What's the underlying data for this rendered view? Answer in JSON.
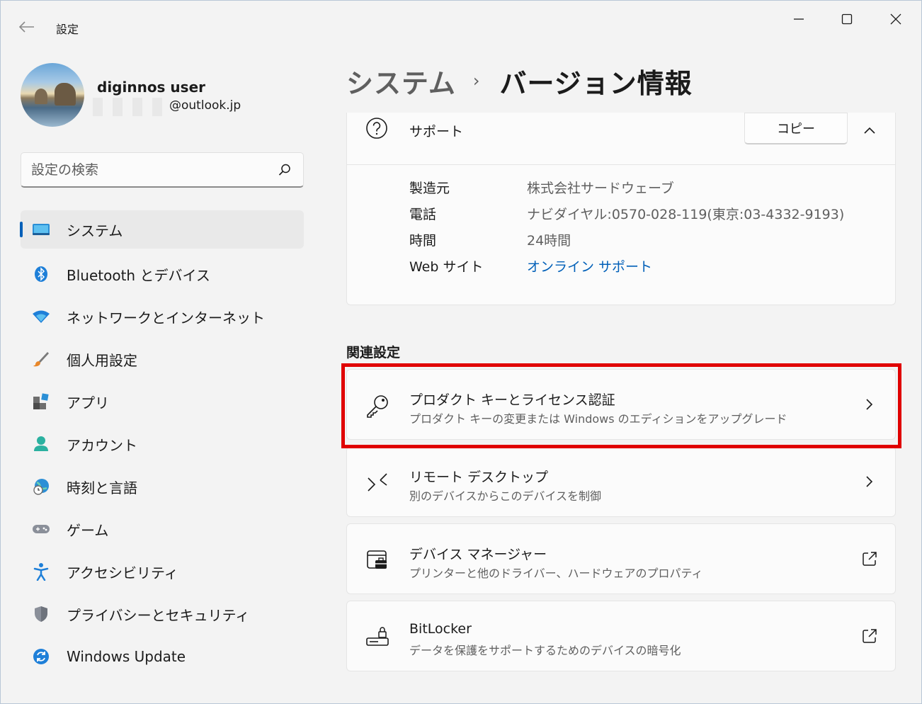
{
  "window": {
    "title": "設定"
  },
  "profile": {
    "name": "diginnos user",
    "email_suffix": "@outlook.jp"
  },
  "search": {
    "placeholder": "設定の検索"
  },
  "nav": {
    "items": [
      {
        "label": "システム",
        "icon": "system-icon"
      },
      {
        "label": "Bluetooth とデバイス",
        "icon": "bluetooth-icon"
      },
      {
        "label": "ネットワークとインターネット",
        "icon": "wifi-icon"
      },
      {
        "label": "個人用設定",
        "icon": "brush-icon"
      },
      {
        "label": "アプリ",
        "icon": "apps-icon"
      },
      {
        "label": "アカウント",
        "icon": "account-icon"
      },
      {
        "label": "時刻と言語",
        "icon": "globe-clock-icon"
      },
      {
        "label": "ゲーム",
        "icon": "gamepad-icon"
      },
      {
        "label": "アクセシビリティ",
        "icon": "accessibility-icon"
      },
      {
        "label": "プライバシーとセキュリティ",
        "icon": "shield-icon"
      },
      {
        "label": "Windows Update",
        "icon": "update-icon"
      }
    ]
  },
  "breadcrumb": {
    "parent": "システム",
    "separator": "›",
    "current": "バージョン情報"
  },
  "support": {
    "title": "サポート",
    "copy_label": "コピー",
    "rows": [
      {
        "label": "製造元",
        "value": "株式会社サードウェーブ"
      },
      {
        "label": "電話",
        "value": "ナビダイヤル:0570-028-119(東京:03-4332-9193)"
      },
      {
        "label": "時間",
        "value": "24時間"
      },
      {
        "label": "Web サイト",
        "value": "オンライン サポート"
      }
    ]
  },
  "related": {
    "title": "関連設定",
    "items": [
      {
        "title": "プロダクト キーとライセンス認証",
        "subtitle": "プロダクト キーの変更または Windows のエディションをアップグレード",
        "trail": "chevron-right-icon"
      },
      {
        "title": "リモート デスクトップ",
        "subtitle": "別のデバイスからこのデバイスを制御",
        "trail": "chevron-right-icon"
      },
      {
        "title": "デバイス マネージャー",
        "subtitle": "プリンターと他のドライバー、ハードウェアのプロパティ",
        "trail": "external-link-icon"
      },
      {
        "title": "BitLocker",
        "subtitle": "データを保護をサポートするためのデバイスの暗号化",
        "trail": "external-link-icon"
      }
    ]
  },
  "colors": {
    "accent": "#005fb8",
    "highlight": "#e00000",
    "background": "#f3f3f3"
  }
}
